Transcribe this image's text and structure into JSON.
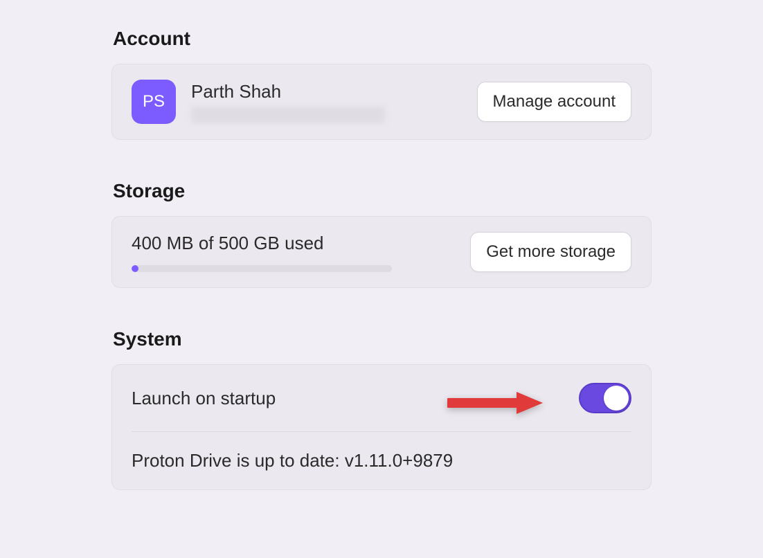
{
  "account": {
    "heading": "Account",
    "avatar_initials": "PS",
    "name": "Parth Shah",
    "manage_button": "Manage account"
  },
  "storage": {
    "heading": "Storage",
    "usage_text": "400 MB of 500 GB used",
    "get_more_button": "Get more storage",
    "progress_percent": 2
  },
  "system": {
    "heading": "System",
    "launch_on_startup_label": "Launch on startup",
    "launch_on_startup_enabled": true,
    "version_text": "Proton Drive is up to date: v1.11.0+9879"
  },
  "annotation": {
    "arrow_color": "#e03a3a"
  }
}
